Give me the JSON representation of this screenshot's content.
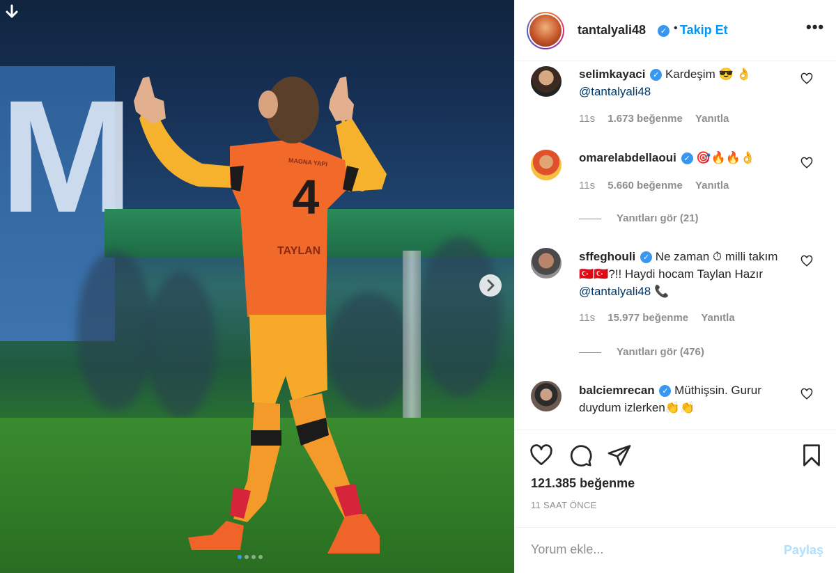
{
  "post": {
    "username": "tantalyali48",
    "follow_label": "Takip Et",
    "more_label": "•••",
    "likes": "121.385 beğenme",
    "time": "11 SAAT ÖNCE"
  },
  "comments": [
    {
      "user": "selimkayaci",
      "verified": true,
      "text": "Kardeşim 😎 👌 ",
      "mention": "@tantalyali48",
      "age": "11s",
      "likes": "1.673 beğenme",
      "reply": "Yanıtla"
    },
    {
      "user": "omarelabdellaoui",
      "verified": true,
      "text": "🎯🔥🔥👌",
      "age": "11s",
      "likes": "5.660 beğenme",
      "reply": "Yanıtla",
      "view_replies": "Yanıtları gör (21)"
    },
    {
      "user": "sffeghouli",
      "verified": true,
      "text": "Ne zaman ⏱ milli takım 🇹🇷🇹🇷?!! Haydi hocam Taylan Hazır ",
      "mention": "@tantalyali48",
      "suffix": " 📞",
      "age": "11s",
      "likes": "15.977 beğenme",
      "reply": "Yanıtla",
      "view_replies": "Yanıtları gör (476)"
    },
    {
      "user": "balciemrecan",
      "verified": true,
      "text": "Müthişsin. Gurur duydum izlerken👏👏"
    }
  ],
  "composer": {
    "placeholder": "Yorum ekle...",
    "share_label": "Paylaş"
  },
  "icons": {
    "download": "arrow-down-icon",
    "next": "chevron-right-icon",
    "like": "heart-icon",
    "comment": "comment-icon",
    "share": "paper-plane-icon",
    "save": "bookmark-icon"
  },
  "photo": {
    "jersey_name": "TAYLAN",
    "jersey_number": "4",
    "sponsor": "MAGNA YAPI"
  },
  "colors": {
    "accent": "#0095f6",
    "verified": "#3897f0",
    "share_disabled": "#b2dffc",
    "jersey": "#f26a2a",
    "sleeves": "#f7b22d"
  }
}
